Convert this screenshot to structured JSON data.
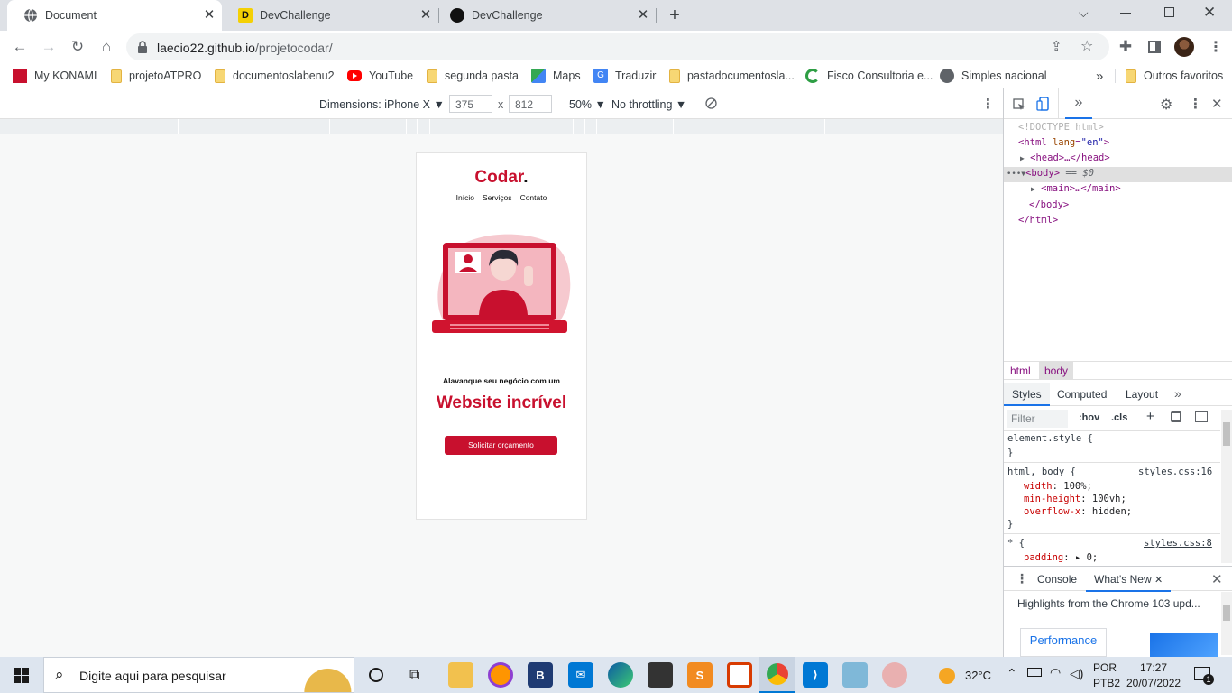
{
  "browser": {
    "tabs": [
      {
        "title": "Document",
        "active": true
      },
      {
        "title": "DevChallenge",
        "active": false
      },
      {
        "title": "DevChallenge",
        "active": false
      }
    ],
    "url_host": "laecio22.github.io",
    "url_path": "/projetocodar/",
    "bookmarks": [
      {
        "label": "My KONAMI",
        "icon": "konami-icon"
      },
      {
        "label": "projetoATPRO",
        "icon": "folder-icon"
      },
      {
        "label": "documentoslabenu2",
        "icon": "folder-icon"
      },
      {
        "label": "YouTube",
        "icon": "youtube-icon"
      },
      {
        "label": "segunda pasta",
        "icon": "folder-icon"
      },
      {
        "label": "Maps",
        "icon": "maps-icon"
      },
      {
        "label": "Traduzir",
        "icon": "translate-icon"
      },
      {
        "label": "pastadocumentosla...",
        "icon": "folder-icon"
      },
      {
        "label": "Fisco Consultoria e...",
        "icon": "fisco-icon"
      },
      {
        "label": "Simples nacional",
        "icon": "globe-icon"
      }
    ],
    "other_bookmarks": "Outros favoritos",
    "more_bookmarks": "»"
  },
  "device_toolbar": {
    "dimensions": "Dimensions: iPhone X ▼",
    "width": "375",
    "times": "x",
    "height": "812",
    "zoom": "50% ▼",
    "throttling": "No throttling ▼"
  },
  "site": {
    "logo": "Codar",
    "logo_dot": ".",
    "nav": [
      "Início",
      "Serviços",
      "Contato"
    ],
    "tagline": "Alavanque seu negócio com um",
    "headline": "Website incrível",
    "cta": "Solicitar orçamento"
  },
  "devtools": {
    "dom": {
      "doctype": "<!DOCTYPE html>",
      "html_open_tag": "<html",
      "lang_attr": "lang",
      "lang_val": "\"en\"",
      "close_bracket": ">",
      "head": "<head>…</head>",
      "body_open": "<body>",
      "body_marker": "== $0",
      "main": "<main>…</main>",
      "body_close": "</body>",
      "html_close": "</html>",
      "ellipsis": "•••"
    },
    "breadcrumb": [
      "html",
      "body"
    ],
    "panel_tabs": [
      "Styles",
      "Computed",
      "Layout",
      "»"
    ],
    "filter_placeholder": "Filter",
    "hov": ":hov",
    "cls": ".cls",
    "styles": {
      "element_style": "element.style {",
      "rule1_selector": "html, body {",
      "rule1_link": "styles.css:16",
      "rule1_props": [
        {
          "name": "width",
          "value": "100%;"
        },
        {
          "name": "min-height",
          "value": "100vh;"
        },
        {
          "name": "overflow-x",
          "value": "hidden;"
        }
      ],
      "rule2_selector": "* {",
      "rule2_link": "styles.css:8",
      "rule2_prop": "padding",
      "rule2_value": "▸ 0;",
      "brace": "}"
    },
    "drawer_tabs": [
      "Console",
      "What's New"
    ],
    "drawer_text": "Highlights from the Chrome 103 upd...",
    "drawer_button": "Performance"
  },
  "taskbar": {
    "search_placeholder": "Digite aqui para pesquisar",
    "weather": "32°C",
    "lang1": "POR",
    "lang2": "PTB2",
    "time": "17:27",
    "date": "20/07/2022",
    "notifications": "1"
  },
  "colors": {
    "brand_red": "#c8102e",
    "chrome_tabstrip": "#dee1e6",
    "devtools_blue": "#1a73e8"
  }
}
